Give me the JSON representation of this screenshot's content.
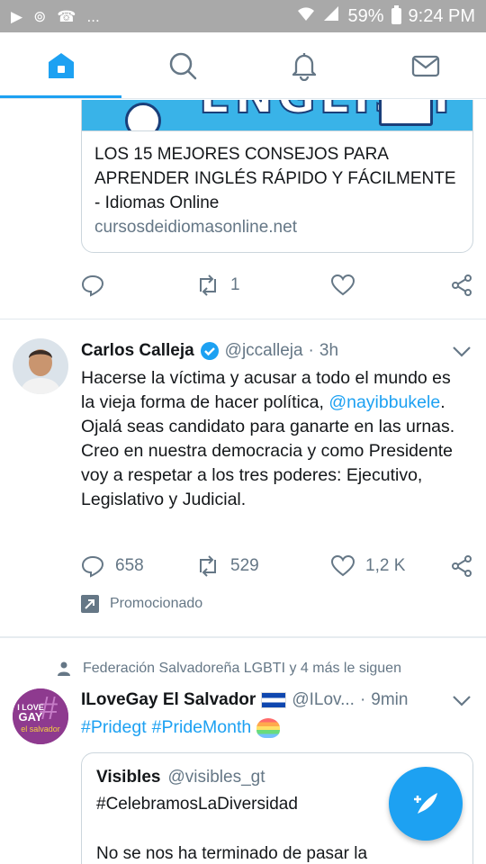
{
  "status_bar": {
    "left_icons": [
      "play-icon",
      "voicemail-icon",
      "missed-call-icon"
    ],
    "more": "...",
    "battery": "59%",
    "time": "9:24 PM",
    "right_icons": [
      "wifi-icon",
      "signal-icon",
      "battery-icon"
    ]
  },
  "nav": {
    "tabs": [
      {
        "name": "home",
        "icon": "home-icon",
        "active": true
      },
      {
        "name": "search",
        "icon": "search-icon",
        "active": false
      },
      {
        "name": "notifications",
        "icon": "bell-icon",
        "active": false
      },
      {
        "name": "messages",
        "icon": "mail-icon",
        "active": false
      }
    ],
    "accent": "#1da1f2"
  },
  "link_card": {
    "image_text": "ENGLISH",
    "title": "LOS 15 MEJORES CONSEJOS PARA APRENDER INGLÉS RÁPIDO Y FÁCILMENTE - Idiomas Online",
    "domain": "cursosdeidiomasonline.net"
  },
  "tweet0_actions": {
    "replies": "",
    "retweets": "1",
    "likes": ""
  },
  "tweet1": {
    "name": "Carlos Calleja",
    "handle": "@jccalleja",
    "dot": "·",
    "time": "3h",
    "text_before": "Hacerse la víctima y acusar a todo el mundo es la vieja forma de hacer política, ",
    "mention": "@nayibbukele",
    "text_after": ". Ojalá seas candidato para ganarte en las urnas. Creo en nuestra democracia y como Presidente voy a respetar a los tres poderes: Ejecutivo, Legislativo y Judicial.",
    "replies": "658",
    "retweets": "529",
    "likes": "1,2 K",
    "promoted": "Promocionado"
  },
  "tweet2": {
    "social_context": "Federación Salvadoreña LGBTI y 4 más le siguen",
    "name": "ILoveGay El Salvador",
    "handle": "@ILov...",
    "dot": "·",
    "time": "9min",
    "hashtag1": "#Pridegt",
    "hashtag2": "#PrideMonth",
    "avatar_line1": "I LOVE",
    "avatar_line2": "GAY",
    "avatar_line3": "el salvador",
    "quote": {
      "name": "Visibles",
      "handle": "@visibles_gt",
      "line1": "#CelebramosLaDiversidad",
      "line2": "No se nos ha terminado de pasar la"
    }
  },
  "compose_button": "compose-tweet"
}
